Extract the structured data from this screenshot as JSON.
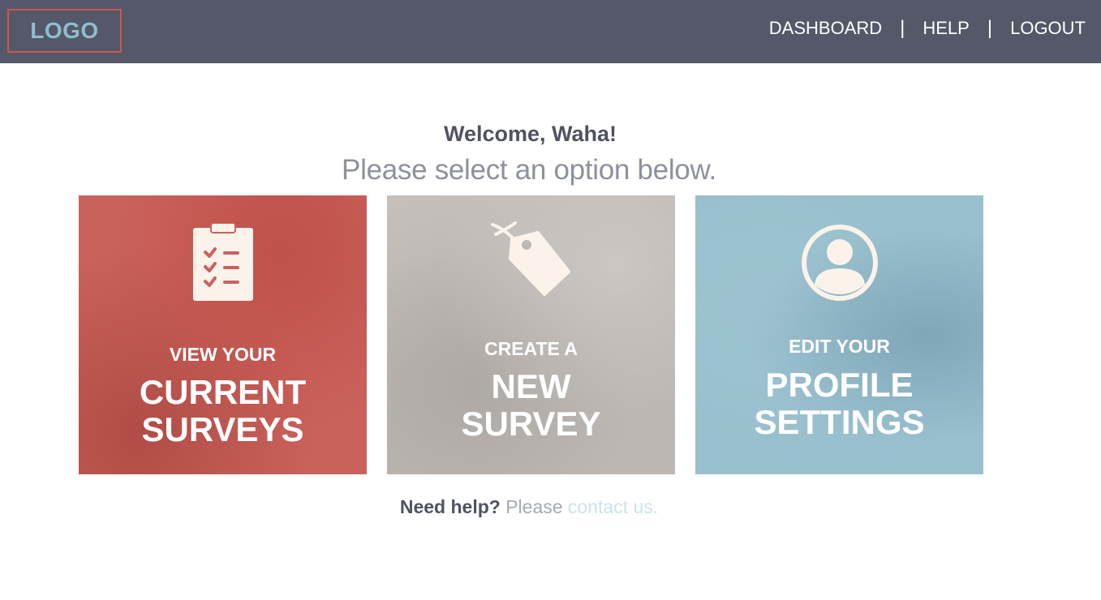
{
  "header": {
    "logo": "LOGO",
    "nav": {
      "dashboard": "DASHBOARD",
      "help": "HELP",
      "logout": "LOGOUT",
      "separator": "|"
    }
  },
  "main": {
    "welcome": "Welcome, Waha!",
    "subtitle": "Please select an option below.",
    "tiles": [
      {
        "line1": "VIEW YOUR",
        "line2": "CURRENT",
        "line3": "SURVEYS",
        "icon": "clipboard-checklist-icon",
        "color": "#ca625c"
      },
      {
        "line1": "CREATE A",
        "line2": "NEW",
        "line3": "SURVEY",
        "icon": "tag-icon",
        "color": "#bdb8b4"
      },
      {
        "line1": "EDIT YOUR",
        "line2": "PROFILE",
        "line3": "SETTINGS",
        "icon": "user-circle-icon",
        "color": "#99c0ce"
      }
    ]
  },
  "footer": {
    "question": "Need help?",
    "please": "Please",
    "link": "contact us."
  },
  "colors": {
    "header_bg": "#545869",
    "logo_border": "#c9574f",
    "logo_text": "#8fbdd0",
    "icon_fill": "#fbf3ea"
  }
}
